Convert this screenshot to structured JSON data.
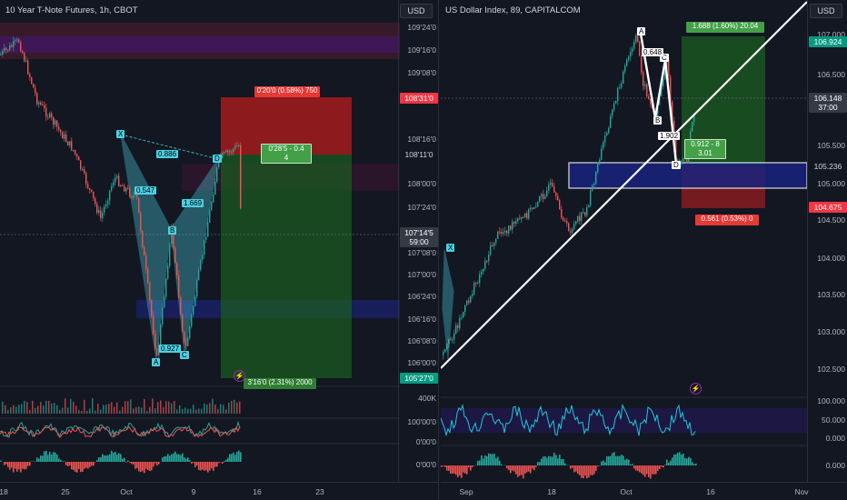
{
  "left_chart": {
    "title": "10 Year T-Note Futures, 1h, CBOT",
    "currency": "USD",
    "price_ticks": [
      "109'24'0",
      "109'16'0",
      "109'08'0",
      "108'16'0",
      "108'00'0",
      "107'24'0",
      "107'08'0",
      "107'00'0",
      "106'24'0",
      "106'16'0",
      "106'08'0",
      "106'00'0"
    ],
    "badges": {
      "red": "108'31'0",
      "current": "108'11'0",
      "gray": "107'14'5",
      "gray2": "59:00",
      "green": "105'27'0"
    },
    "stop_label": "0'20'0 (0.58%) 750",
    "target_label": "3'16'0 (2.31%) 2000",
    "ratio_label_1": "0'28'5 - 0.4",
    "ratio_label_2": "4",
    "pattern_points": {
      "x": "X",
      "a": "A",
      "b": "B",
      "c": "C",
      "d": "D"
    },
    "pattern_ratios": {
      "xb": "0.886",
      "xa": "0.547",
      "bc": "1.669",
      "ac": "0.927"
    },
    "indicator_ticks": [
      "400K",
      "100'00'0",
      "0'00'0",
      "0'00'0"
    ],
    "time_labels": [
      "18",
      "25",
      "Oct",
      "9",
      "16",
      "23"
    ]
  },
  "right_chart": {
    "title": "US Dollar Index, 89, CAPITALCOM",
    "currency": "USD",
    "price_ticks": [
      "107.000",
      "106.500",
      "105.500",
      "105.000",
      "104.500",
      "104.000",
      "103.500",
      "103.000",
      "102.500"
    ],
    "badges": {
      "green": "106.924",
      "gray": "106.148",
      "gray2": "37:00",
      "current": "105.236",
      "red": "104.675"
    },
    "target_label": "1.688 (1.60%) 20.04",
    "stop_label": "0.561 (0.53%) 0",
    "ratio_label_1": "0.912 - 8",
    "ratio_label_2": "3.01",
    "pattern_points": {
      "x": "X",
      "a": "A",
      "b": "B",
      "c": "C",
      "d": "D"
    },
    "pattern_ratios": {
      "ab": "0.648",
      "cd": "1.902"
    },
    "indicator_ticks": [
      "100.000",
      "50.000",
      "0.000",
      "0.000"
    ],
    "time_labels": [
      "Sep",
      "18",
      "Oct",
      "16",
      "Nov"
    ]
  },
  "colors": {
    "bg": "#131722",
    "up": "#26a69a",
    "down": "#ef5350",
    "pattern": "#4dd0e1",
    "tp_green": "#1b5e20",
    "sl_red": "#b71c1c"
  }
}
